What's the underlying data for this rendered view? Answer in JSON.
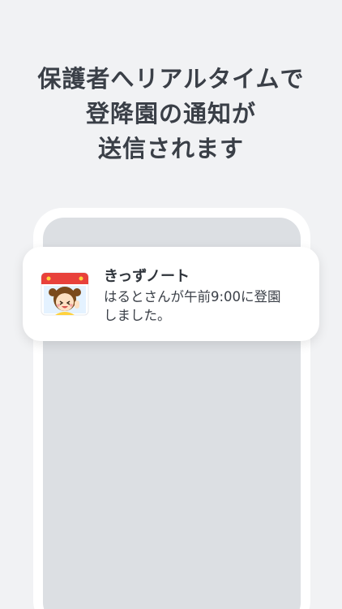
{
  "headline": {
    "line1": "保護者へリアルタイムで",
    "line2": "登降園の通知が",
    "line3": "送信されます"
  },
  "notification": {
    "app_name": "きっずノート",
    "message_line1": "はるとさんが午前9:00に登園",
    "message_line2": "しました。",
    "icon": "kids-note-app-icon"
  }
}
